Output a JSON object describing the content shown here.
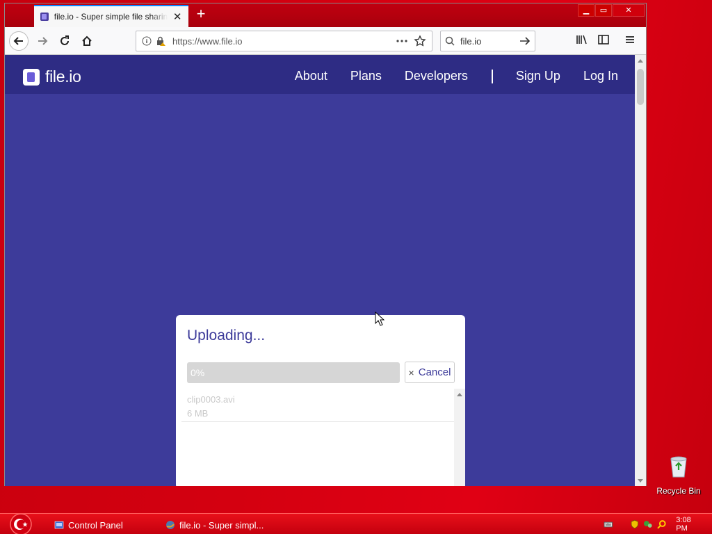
{
  "browser": {
    "tab_title": "file.io - Super simple file sharing",
    "tab_close": "✕",
    "new_tab": "+",
    "url": "https://www.file.io",
    "search_value": "file.io",
    "win_minimize": "▁",
    "win_maximize": "▭",
    "win_close": "✕"
  },
  "site": {
    "logo_text": "file.io",
    "nav": {
      "about": "About",
      "plans": "Plans",
      "developers": "Developers",
      "signup": "Sign Up",
      "login": "Log In"
    },
    "bg_color": "#3d3b9a",
    "header_color": "#2e2c84"
  },
  "upload": {
    "title": "Uploading...",
    "progress": 0,
    "progress_label": "0%",
    "cancel_label": "Cancel",
    "cancel_icon": "×",
    "files": [
      {
        "name": "clip0003.avi",
        "size": "6 MB"
      }
    ]
  },
  "desktop": {
    "recycle_bin_label": "Recycle Bin"
  },
  "taskbar": {
    "tasks": [
      {
        "label": "Control Panel"
      },
      {
        "label": "file.io - Super simpl..."
      }
    ],
    "clock": "3:08 PM"
  }
}
